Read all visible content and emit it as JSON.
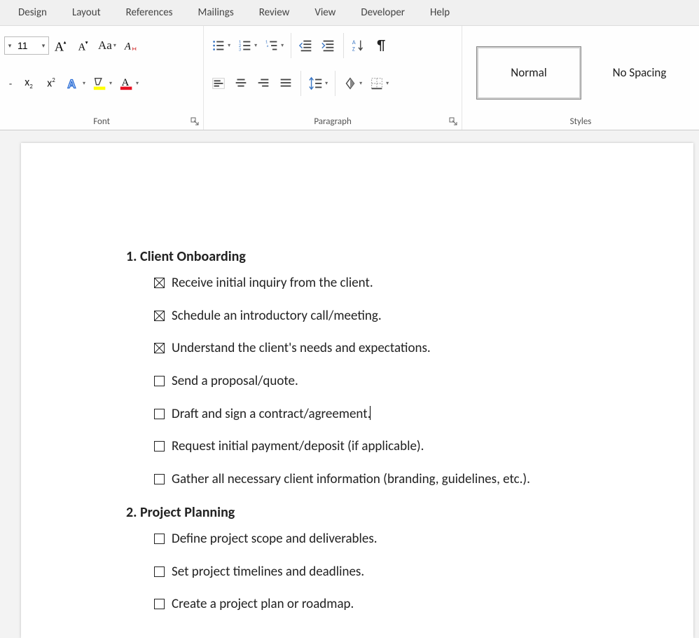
{
  "tabs": [
    "Design",
    "Layout",
    "References",
    "Mailings",
    "Review",
    "View",
    "Developer",
    "Help"
  ],
  "font": {
    "size": "11",
    "group_label": "Font"
  },
  "paragraph": {
    "group_label": "Paragraph"
  },
  "styles": {
    "group_label": "Styles",
    "items": [
      "Normal",
      "No Spacing"
    ],
    "selected": 0
  },
  "doc": {
    "sections": [
      {
        "title": "1. Client Onboarding",
        "items": [
          {
            "checked": true,
            "text": "Receive initial inquiry from the client."
          },
          {
            "checked": true,
            "text": "Schedule an introductory call/meeting."
          },
          {
            "checked": true,
            "text": "Understand the client's needs and expectations."
          },
          {
            "checked": false,
            "text": "Send a proposal/quote."
          },
          {
            "checked": false,
            "text": "Draft and sign a contract/agreement.",
            "cursor": true
          },
          {
            "checked": false,
            "text": "Request initial payment/deposit (if applicable)."
          },
          {
            "checked": false,
            "text": "Gather all necessary client information (branding, guidelines, etc.)."
          }
        ]
      },
      {
        "title": "2. Project Planning",
        "items": [
          {
            "checked": false,
            "text": "Define project scope and deliverables."
          },
          {
            "checked": false,
            "text": "Set project timelines and deadlines."
          },
          {
            "checked": false,
            "text": "Create a project plan or roadmap."
          }
        ]
      }
    ]
  }
}
